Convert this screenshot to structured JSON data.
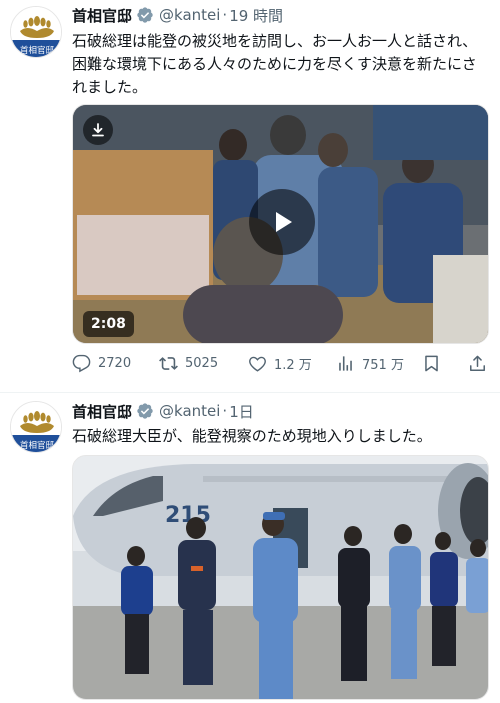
{
  "tweets": [
    {
      "author_name": "首相官邸",
      "handle": "@kantei",
      "separator": "·",
      "time": "19 時間",
      "text": "石破総理は能登の被災地を訪問し、お一人お一人と話され、困難な環境下にある人々のために力を尽くす決意を新たにされました。",
      "video_duration": "2:08",
      "stats": {
        "replies": "2720",
        "retweets": "5025",
        "likes": "1.2 万",
        "views": "751 万"
      }
    },
    {
      "author_name": "首相官邸",
      "handle": "@kantei",
      "separator": "·",
      "time": "1日",
      "text": "石破総理大臣が、能登視察のため現地入りしました。",
      "aircraft_number": "215"
    }
  ],
  "avatar_text": "首相官邸",
  "colors": {
    "verified_badge": "#1d9bf0",
    "secondary_text": "#536471",
    "avatar_blue": "#1f4f9a",
    "avatar_gold": "#b08a2e"
  },
  "icons": {
    "reply": "speech-bubble",
    "retweet": "retweet-arrows",
    "like": "heart",
    "views": "bar-chart",
    "bookmark": "bookmark",
    "share": "upload-arrow",
    "download": "download-arrow",
    "play": "play-triangle"
  }
}
